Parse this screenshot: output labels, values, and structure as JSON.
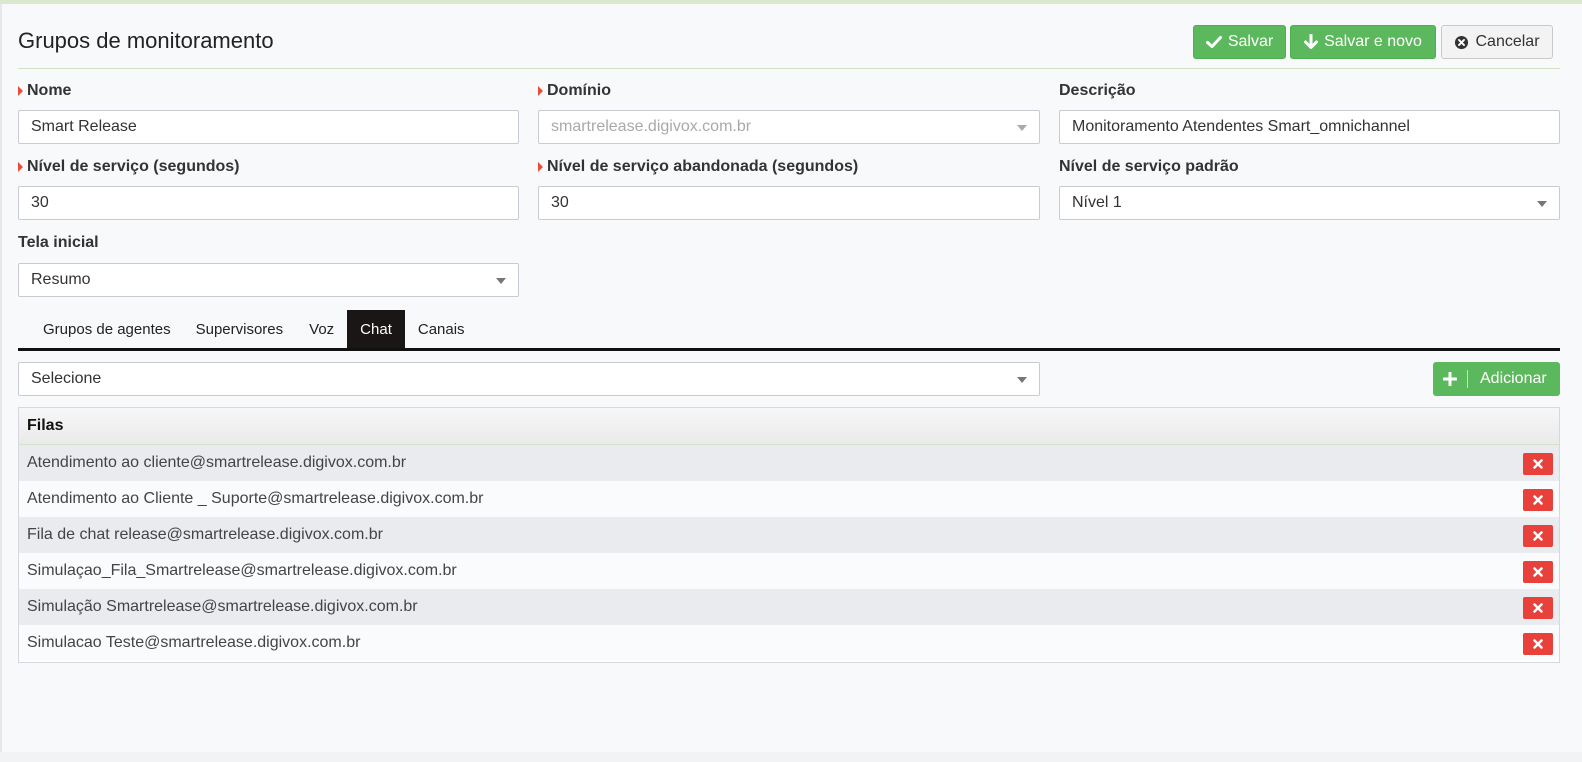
{
  "header": {
    "title": "Grupos de monitoramento",
    "save_label": "Salvar",
    "save_new_label": "Salvar e novo",
    "cancel_label": "Cancelar"
  },
  "form": {
    "nome": {
      "label": "Nome",
      "value": "Smart Release",
      "required": true
    },
    "dominio": {
      "label": "Domínio",
      "value": "smartrelease.digivox.com.br",
      "required": true,
      "disabled": true
    },
    "descricao": {
      "label": "Descrição",
      "value": "Monitoramento Atendentes Smart_omnichannel",
      "required": false
    },
    "nivel_servico": {
      "label": "Nível de serviço (segundos)",
      "value": "30",
      "required": true
    },
    "nivel_servico_abandonada": {
      "label": "Nível de serviço abandonada (segundos)",
      "value": "30",
      "required": true
    },
    "nivel_servico_padrao": {
      "label": "Nível de serviço padrão",
      "value": "Nível 1",
      "required": false
    },
    "tela_inicial": {
      "label": "Tela inicial",
      "value": "Resumo",
      "required": false
    }
  },
  "tabs": [
    {
      "label": "Grupos de agentes",
      "active": false
    },
    {
      "label": "Supervisores",
      "active": false
    },
    {
      "label": "Voz",
      "active": false
    },
    {
      "label": "Chat",
      "active": true
    },
    {
      "label": "Canais",
      "active": false
    }
  ],
  "chat": {
    "select_value": "Selecione",
    "add_label": "Adicionar",
    "table_header": "Filas",
    "rows": [
      "Atendimento ao cliente@smartrelease.digivox.com.br",
      "Atendimento ao Cliente _ Suporte@smartrelease.digivox.com.br",
      "Fila de chat release@smartrelease.digivox.com.br",
      "Simulaçao_Fila_Smartrelease@smartrelease.digivox.com.br",
      "Simulação Smartrelease@smartrelease.digivox.com.br",
      "Simulacao Teste@smartrelease.digivox.com.br"
    ]
  },
  "colors": {
    "success": "#5cb85c",
    "danger": "#e8403a",
    "required_marker": "#e84c3d",
    "active_tab": "#1a1615"
  },
  "icons": {
    "save": "check-icon",
    "save_new": "arrow-down-icon",
    "cancel": "times-circle-icon",
    "add": "plus-icon",
    "delete": "times-icon",
    "dropdown": "caret-down-icon"
  }
}
